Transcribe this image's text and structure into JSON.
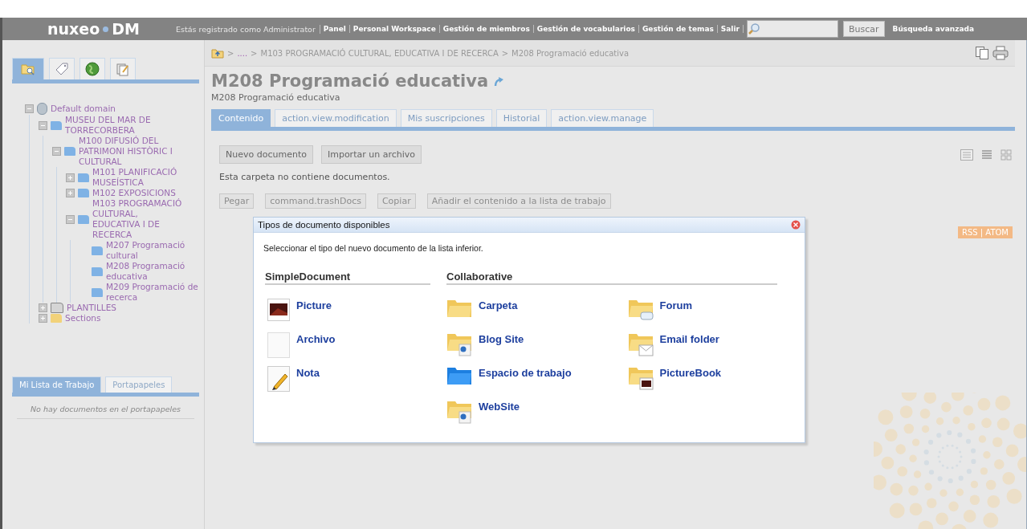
{
  "header": {
    "logo_left": "nuxeo",
    "logo_right": "DM",
    "user_text": "Estás registrado como Administrator",
    "links": [
      "Panel",
      "Personal Workspace",
      "Gestión de miembros",
      "Gestión de vocabularios",
      "Gestión de temas",
      "Salir"
    ],
    "search": {
      "button": "Buscar"
    },
    "advanced": "Búsqueda avanzada"
  },
  "sidebar": {
    "tabs": [
      {
        "kind": "search",
        "selected": true
      },
      {
        "kind": "tag",
        "selected": false
      },
      {
        "kind": "globe",
        "selected": false
      },
      {
        "kind": "documents",
        "selected": false
      }
    ],
    "tree": [
      {
        "label": "Default domain",
        "kind": "domain",
        "expanded": true,
        "children": [
          {
            "label": "MUSEU DEL MAR DE TORRECORBERA",
            "kind": "folder",
            "expanded": true,
            "children": [
              {
                "label": "M100 DIFUSIÓ DEL PATRIMONI HISTÒRIC I CULTURAL",
                "kind": "folder",
                "expanded": true,
                "children": [
                  {
                    "label": "M101 PLANIFICACIÓ MUSEÍSTICA",
                    "kind": "folder",
                    "expanded": false
                  },
                  {
                    "label": "M102 EXPOSICIONS",
                    "kind": "folder",
                    "expanded": false
                  },
                  {
                    "label": "M103 PROGRAMACIÓ CULTURAL, EDUCATIVA I DE RECERCA",
                    "kind": "folder",
                    "expanded": true,
                    "children": [
                      {
                        "label": "M207 Programació cultural",
                        "kind": "folder"
                      },
                      {
                        "label": "M208 Programació educativa",
                        "kind": "folder"
                      },
                      {
                        "label": "M209 Programació de recerca",
                        "kind": "folder"
                      }
                    ]
                  }
                ]
              }
            ]
          },
          {
            "label": "PLANTILLES",
            "kind": "templates",
            "expanded": false
          },
          {
            "label": "Sections",
            "kind": "sections",
            "expanded": false
          }
        ]
      }
    ],
    "bottom_tabs": [
      {
        "label": "Mi Lista de Trabajo",
        "selected": true
      },
      {
        "label": "Portapapeles",
        "selected": false
      }
    ],
    "empty_message": "No hay documentos en el portapapeles"
  },
  "breadcrumb": {
    "separator": ">",
    "items": [
      "....",
      "M103 PROGRAMACIÓ CULTURAL, EDUCATIVA I DE RECERCA",
      "M208 Programació educativa"
    ]
  },
  "title": "M208 Programació educativa",
  "subtitle": "M208 Programació educativa",
  "tabs": [
    {
      "label": "Contenido",
      "selected": true
    },
    {
      "label": "action.view.modification",
      "selected": false
    },
    {
      "label": "Mis suscripciones",
      "selected": false
    },
    {
      "label": "Historial",
      "selected": false
    },
    {
      "label": "action.view.manage",
      "selected": false
    }
  ],
  "actions": [
    {
      "label": "Nuevo documento",
      "disabled": false
    },
    {
      "label": "Importar un archivo",
      "disabled": false
    }
  ],
  "empty_text": "Esta carpeta no contiene documentos.",
  "list_actions": [
    {
      "label": "Pegar",
      "disabled": true
    },
    {
      "label": "command.trashDocs",
      "disabled": true
    },
    {
      "label": "Copiar",
      "disabled": true
    },
    {
      "label": "Añadir el contenido a la lista de trabajo",
      "disabled": true
    }
  ],
  "feed_badge": "RSS | ATOM",
  "dialog": {
    "title": "Tipos de documento disponibles",
    "instruction": "Seleccionar el tipo del nuevo documento de la lista inferior.",
    "groups": [
      {
        "name": "SimpleDocument",
        "types": [
          {
            "label": "Picture",
            "kind": "picture"
          },
          {
            "label": "Archivo",
            "kind": "file"
          },
          {
            "label": "Nota",
            "kind": "note"
          }
        ]
      },
      {
        "name": "Collaborative",
        "types": [
          {
            "label": "Carpeta",
            "kind": "folder"
          },
          {
            "label": "Blog Site",
            "kind": "blog"
          },
          {
            "label": "Espacio de trabajo",
            "kind": "workspace"
          },
          {
            "label": "WebSite",
            "kind": "website"
          },
          {
            "label": "Forum",
            "kind": "forum"
          },
          {
            "label": "Email folder",
            "kind": "email"
          },
          {
            "label": "PictureBook",
            "kind": "picturebook"
          }
        ]
      }
    ]
  }
}
